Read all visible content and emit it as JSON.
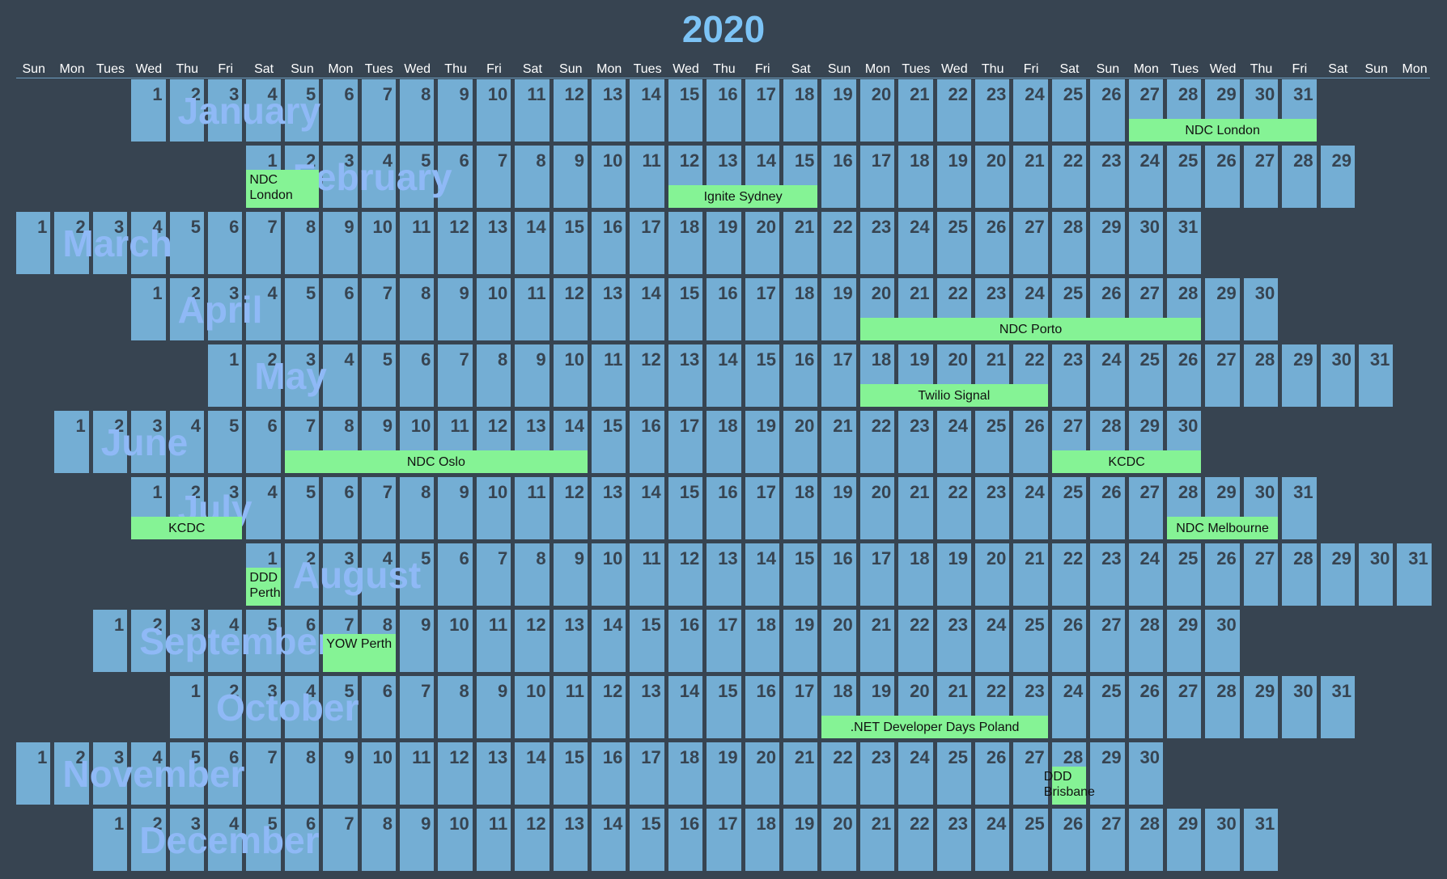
{
  "title": "2020",
  "colors": {
    "background": "#374451",
    "cell": "#74aed4",
    "event": "#85f395",
    "title": "#7cc3f5",
    "month_label": "#8fb9f6"
  },
  "weekday_headers": [
    "Sun",
    "Mon",
    "Tues",
    "Wed",
    "Thu",
    "Fri",
    "Sat",
    "Sun",
    "Mon",
    "Tues",
    "Wed",
    "Thu",
    "Fri",
    "Sat",
    "Sun",
    "Mon",
    "Tues",
    "Wed",
    "Thu",
    "Fri",
    "Sat",
    "Sun",
    "Mon",
    "Tues",
    "Wed",
    "Thu",
    "Fri",
    "Sat",
    "Sun",
    "Mon",
    "Tues",
    "Wed",
    "Thu",
    "Fri",
    "Sat",
    "Sun",
    "Mon"
  ],
  "months": [
    {
      "name": "January",
      "first_weekday": 3,
      "days": 31
    },
    {
      "name": "February",
      "first_weekday": 6,
      "days": 29
    },
    {
      "name": "March",
      "first_weekday": 0,
      "days": 31
    },
    {
      "name": "April",
      "first_weekday": 3,
      "days": 30
    },
    {
      "name": "May",
      "first_weekday": 5,
      "days": 31
    },
    {
      "name": "June",
      "first_weekday": 1,
      "days": 30
    },
    {
      "name": "July",
      "first_weekday": 3,
      "days": 31
    },
    {
      "name": "August",
      "first_weekday": 6,
      "days": 31
    },
    {
      "name": "September",
      "first_weekday": 2,
      "days": 30
    },
    {
      "name": "October",
      "first_weekday": 4,
      "days": 31
    },
    {
      "name": "November",
      "first_weekday": 0,
      "days": 30
    },
    {
      "name": "December",
      "first_weekday": 2,
      "days": 31
    }
  ],
  "events": [
    {
      "name": "NDC London",
      "month": 1,
      "start": 27,
      "end": 31
    },
    {
      "name": "NDC London",
      "month": 2,
      "start": 1,
      "end": 2,
      "wrap": true
    },
    {
      "name": "Ignite Sydney",
      "month": 2,
      "start": 12,
      "end": 15
    },
    {
      "name": "NDC Porto",
      "month": 4,
      "start": 20,
      "end": 28
    },
    {
      "name": "Twilio Signal",
      "month": 5,
      "start": 18,
      "end": 22
    },
    {
      "name": "NDC Oslo",
      "month": 6,
      "start": 7,
      "end": 14
    },
    {
      "name": "KCDC",
      "month": 6,
      "start": 27,
      "end": 30
    },
    {
      "name": "KCDC",
      "month": 7,
      "start": 1,
      "end": 3
    },
    {
      "name": "NDC Melbourne",
      "month": 7,
      "start": 28,
      "end": 30
    },
    {
      "name": "DDD Perth",
      "month": 8,
      "start": 1,
      "end": 1,
      "wrap": true
    },
    {
      "name": "YOW Perth",
      "month": 9,
      "start": 7,
      "end": 8,
      "wrap": true
    },
    {
      "name": ".NET Developer Days Poland",
      "month": 10,
      "start": 18,
      "end": 23
    },
    {
      "name": "DDD Brisbane",
      "month": 11,
      "start": 28,
      "end": 28,
      "wrap": true,
      "overflow": true
    }
  ]
}
